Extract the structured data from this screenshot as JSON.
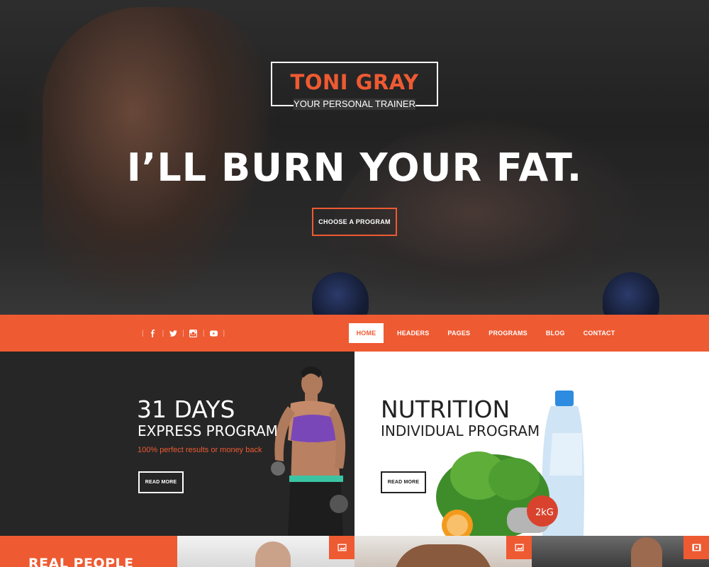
{
  "hero": {
    "logo_name": "TONI GRAY",
    "logo_tagline": "YOUR PERSONAL TRAINER",
    "headline": "I’LL BURN YOUR FAT.",
    "cta_label": "CHOOSE A PROGRAM"
  },
  "nav": {
    "social_icons": [
      "facebook-icon",
      "twitter-icon",
      "instagram-icon",
      "youtube-icon"
    ],
    "items": [
      {
        "label": "HOME",
        "active": true
      },
      {
        "label": "HEADERS"
      },
      {
        "label": "PAGES"
      },
      {
        "label": "PROGRAMS"
      },
      {
        "label": "BLOG"
      },
      {
        "label": "CONTACT"
      }
    ]
  },
  "programs": [
    {
      "title": "31 DAYS",
      "subtitle": "EXPRESS PROGRAM",
      "note": "100% perfect results or money back",
      "button": "READ MORE"
    },
    {
      "title": "NUTRITION",
      "subtitle": "INDIVIDUAL PROGRAM",
      "button": "READ MORE",
      "bottle_label": "2kG"
    }
  ],
  "gallery": {
    "heading": "REAL PEOPLE",
    "badges": [
      "image-icon",
      "image-icon",
      "video-icon"
    ]
  },
  "colors": {
    "accent": "#ee5a32",
    "dark_panel": "#262626",
    "white": "#ffffff"
  }
}
